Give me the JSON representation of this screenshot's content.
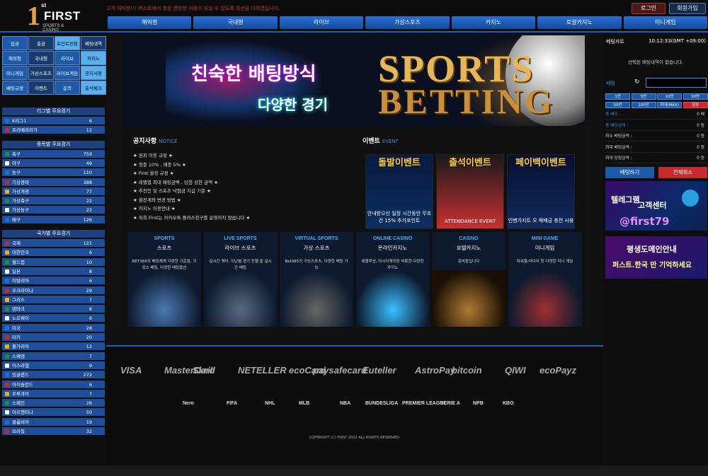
{
  "header": {
    "logo": {
      "number": "1",
      "suffix": "st",
      "name": "FIRST",
      "tagline": "SPORTS & CASINO"
    },
    "ticker": "고객 여러분!!! 퍼스트에서 항상 편안한 이용이 되실 수 있도록 최선을 다하겠습니다.",
    "login_label": "로그인",
    "join_label": "회원가입",
    "nav": [
      "해외형",
      "국내형",
      "라이브",
      "가상스포츠",
      "카지노",
      "로얄카지노",
      "미니게임"
    ]
  },
  "sidebar": {
    "quick": [
      "입금",
      "출금",
      "포인트전환",
      "베팅내역",
      "해외형",
      "국내형",
      "라이브",
      "카지노",
      "미니게임",
      "가상스포츠",
      "라이브게임",
      "공지사항",
      "베팅규정",
      "이벤트",
      "문의",
      "출석체크"
    ],
    "sections": [
      {
        "title": "리그별 주요경기",
        "items": [
          {
            "label": "K리그1",
            "count": "6"
          },
          {
            "label": "프리메라리가",
            "count": "12"
          }
        ]
      },
      {
        "title": "종목별 주요경기",
        "items": [
          {
            "label": "축구",
            "count": "759"
          },
          {
            "label": "야구",
            "count": "49"
          },
          {
            "label": "농구",
            "count": "110"
          },
          {
            "label": "기상경마",
            "count": "388"
          },
          {
            "label": "가상개경",
            "count": "77"
          },
          {
            "label": "가상축구",
            "count": "22"
          },
          {
            "label": "가상농구",
            "count": "22"
          },
          {
            "label": "배구",
            "count": "126"
          }
        ]
      },
      {
        "title": "국가별 주요경기",
        "items": [
          {
            "label": "국제",
            "count": "121"
          },
          {
            "label": "대한민국",
            "count": "6"
          },
          {
            "label": "월드컵",
            "count": "10"
          },
          {
            "label": "일본",
            "count": "8"
          },
          {
            "label": "이탈리아",
            "count": "6"
          },
          {
            "label": "우크라이나",
            "count": "29"
          },
          {
            "label": "그리스",
            "count": "7"
          },
          {
            "label": "덴마크",
            "count": "8"
          },
          {
            "label": "노르웨이",
            "count": "6"
          },
          {
            "label": "미국",
            "count": "28"
          },
          {
            "label": "터키",
            "count": "20"
          },
          {
            "label": "불가리아",
            "count": "12"
          },
          {
            "label": "스웨덴",
            "count": "7"
          },
          {
            "label": "이스라엘",
            "count": "9"
          },
          {
            "label": "잉글랜드",
            "count": "272"
          },
          {
            "label": "아이슬란드",
            "count": "6"
          },
          {
            "label": "우루과이",
            "count": "7"
          },
          {
            "label": "스페인",
            "count": "26"
          },
          {
            "label": "아르헨티나",
            "count": "50"
          },
          {
            "label": "콜롬비아",
            "count": "19"
          },
          {
            "label": "브라질",
            "count": "32"
          }
        ]
      }
    ]
  },
  "banner": {
    "line1": "친숙한 배팅방식",
    "line2": "다양한 경기",
    "title1": "SPORTS",
    "title2": "BETTING"
  },
  "notice": {
    "title": "공지사항",
    "title_en": "NOTICE",
    "items": [
      "★ 원피 이용 규정 ★",
      "★ 첫충 10% , 매충 5% ★",
      "★ First 올킹 규정 ★",
      "★ 레벨별 최대 배팅금액 , 당첨 상한 금액 ★",
      "★ 추천인 및 스포츠 낙첨금 지급 기준 ★",
      "★ 환전계좌 변경 방법 ★",
      "★ 카지노 이용안내 ★",
      "★ 저희 First는 카카오톡 플러스친구를 운영하지 않습니다 ★"
    ]
  },
  "events": {
    "title": "이벤트",
    "title_en": "EVENT",
    "cards": [
      {
        "title": "돌발이벤트",
        "caption": "안내받으신 일정 시간동안 무조건 15% 추가포인트"
      },
      {
        "title": "출석이벤트",
        "caption": "ATTENDANCE EVENT"
      },
      {
        "title": "페이백이벤트",
        "caption": "인벤가지트 오 패배금 충전 사용"
      }
    ]
  },
  "categories": [
    {
      "en": "SPORTS",
      "ko": "스포츠",
      "desc": "BET365의 배당체계 다양한 기준점, 크로스 베팅, 다양한 배팅옵션"
    },
    {
      "en": "LIVE SPORTS",
      "ko": "라이브 스포츠",
      "desc": "실시간 쿼터, 이닝별 경기 진행 중 실시간 배팅"
    },
    {
      "en": "VIRTUAL SPORTS",
      "ko": "가상 스포츠",
      "desc": "Bet365의 가상스포츠, 다양한 배팅 가능"
    },
    {
      "en": "ONLINE CASINO",
      "ko": "온라인카지노",
      "desc": "에볼루션, 아시아게이밍 비롯한 다양한 카지노"
    },
    {
      "en": "CASINO",
      "ko": "호텔카지노",
      "desc": "준비중입니다"
    },
    {
      "en": "MINI GAME",
      "ko": "미니게임",
      "desc": "파워볼/사다리 등 다양한 미니 게임"
    }
  ],
  "betslip": {
    "title": "베팅카트",
    "clock": "10:12:33(GMT +09:00)",
    "empty_msg": "선택된 배팅내역이 없습니다.",
    "bet_label": "배팅",
    "amounts": [
      "1만",
      "5만",
      "10만",
      "30만",
      "50만",
      "100만",
      "최대(MAX)",
      "정정"
    ],
    "info": [
      {
        "label": "총 배당 :",
        "value": "0 배"
      },
      {
        "label": "총 배당금액 :",
        "value": "0 원"
      },
      {
        "label": "최소 배팅금액 :",
        "value": "0 원"
      },
      {
        "label": "최대 배팅금액 :",
        "value": "0 원"
      },
      {
        "label": "최대 당첨금액 :",
        "value": "0 원"
      }
    ],
    "bet_button": "베팅하기",
    "cancel_button": "전체취소",
    "promo1": {
      "l1": "텔레그램",
      "l2": "고객센터",
      "l3": "@first79"
    },
    "promo2": {
      "l1": "평생도메인안내",
      "l2": "퍼스트.한국 만 기억하세요"
    }
  },
  "footer": {
    "payments": [
      "VISA",
      "MasterCard",
      "Skrill",
      "NETELLER",
      "ecoCard",
      "paysafecard",
      "Euteller",
      "AstroPay",
      "bitcoin",
      "QIWI",
      "ecoPayz"
    ],
    "leagues": [
      "Nero",
      "FIFA",
      "NHL",
      "MLB",
      "NBA",
      "BUNDESLIGA",
      "PREMIER LEAGUE",
      "SERIE A",
      "NPB",
      "KBO"
    ],
    "copyright": "COPYRIGHT (C) FIRST 2022 ALL RIGHTS RESERVED."
  },
  "colors": {
    "accent": "#1d5aa8",
    "danger": "#c62b2b",
    "gold": "#e6b65a",
    "flags": [
      "#1b6fd8",
      "#c62b2b",
      "#e8b020",
      "#1b8f3a",
      "#ffffff"
    ]
  }
}
